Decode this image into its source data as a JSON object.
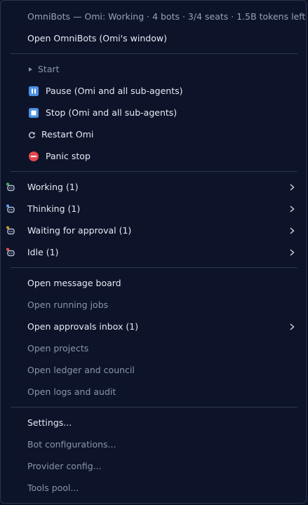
{
  "header": {
    "status": "OmniBots — Omi: Working · 4 bots · 3/4 seats · 1.5B tokens left"
  },
  "open_window": {
    "label": "Open OmniBots (Omi's window)"
  },
  "controls": {
    "start": {
      "label": "Start"
    },
    "pause": {
      "label": "Pause  (Omi and all sub-agents)",
      "icon": "pause-icon"
    },
    "stop": {
      "label": "Stop  (Omi and all sub-agents)",
      "icon": "stop-icon"
    },
    "restart": {
      "label": "Restart Omi",
      "icon": "restart-icon"
    },
    "panic": {
      "label": "Panic stop",
      "icon": "panic-icon"
    }
  },
  "statuses": [
    {
      "label": "Working (1)",
      "icon": "bot-icon",
      "dot_color": "#3fb950"
    },
    {
      "label": "Thinking (1)",
      "icon": "bot-icon",
      "dot_color": "#58a6ff"
    },
    {
      "label": "Waiting for approval (1)",
      "icon": "bot-icon",
      "dot_color": "#d29922"
    },
    {
      "label": "Idle (1)",
      "icon": "bot-icon",
      "dot_color": "#f85149"
    }
  ],
  "open_items": [
    {
      "label": "Open message board",
      "enabled": true
    },
    {
      "label": "Open running jobs",
      "enabled": false
    },
    {
      "label": "Open approvals inbox (1)",
      "enabled": true,
      "submenu": true
    },
    {
      "label": "Open projects",
      "enabled": false
    },
    {
      "label": "Open ledger and council",
      "enabled": false
    },
    {
      "label": "Open logs and audit",
      "enabled": false
    }
  ],
  "settings_items": [
    {
      "label": "Settings...",
      "enabled": true
    },
    {
      "label": "Bot configurations...",
      "enabled": false
    },
    {
      "label": "Provider config...",
      "enabled": false
    },
    {
      "label": "Tools pool...",
      "enabled": false
    }
  ],
  "colors": {
    "background": "#0d1429",
    "pause_blue": "#4a90e2",
    "panic_red": "#e5484d"
  }
}
